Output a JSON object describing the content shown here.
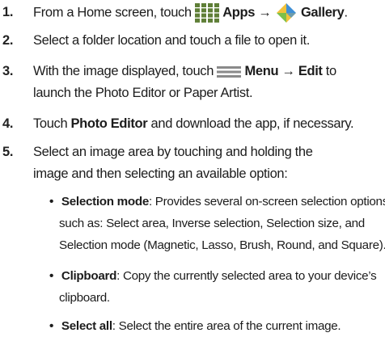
{
  "steps": [
    {
      "number": "1.",
      "text_before": "From a Home screen, touch ",
      "apps_label": "Apps",
      "arrow": " → ",
      "gallery_label": "Gallery",
      "text_after": "."
    },
    {
      "number": "2.",
      "text": "Select a folder location and touch a file to open it."
    },
    {
      "number": "3.",
      "line1_before": "With the image displayed, touch ",
      "menu_label": "Menu",
      "arrow": " → ",
      "edit_label": "Edit",
      "line1_after": " to",
      "line2": "launch the Photo Editor or Paper Artist."
    },
    {
      "number": "4.",
      "text_before": "Touch ",
      "bold_label": "Photo Editor",
      "text_after": " and download the app, if necessary."
    },
    {
      "number": "5.",
      "line1": "Select an image area by touching and holding the",
      "line2": "image and then selecting an available option:"
    }
  ],
  "bullets": [
    {
      "bullet": "•",
      "term": "Selection mode",
      "line1_after": ": Provides several on-screen selection options",
      "line2": "such as: Select area, Inverse selection, Selection size, and",
      "line3": "Selection mode (Magnetic, Lasso, Brush, Round, and Square)."
    },
    {
      "bullet": "•",
      "term": "Clipboard",
      "line1_after": ": Copy the currently selected area to your device’s",
      "line2": "clipboard."
    },
    {
      "bullet": "•",
      "term": "Select all",
      "line1_after": ": Select the entire area of the current image."
    }
  ],
  "icons": {
    "apps": "apps-grid-icon",
    "gallery": "gallery-icon",
    "menu": "menu-icon"
  },
  "colors": {
    "apps_icon_cell": "#5f7f37",
    "gallery_blue": "#3f8fd6",
    "gallery_yellow": "#f2c23a",
    "gallery_green": "#7cc04a",
    "menu_icon": "#8a8a8a"
  }
}
